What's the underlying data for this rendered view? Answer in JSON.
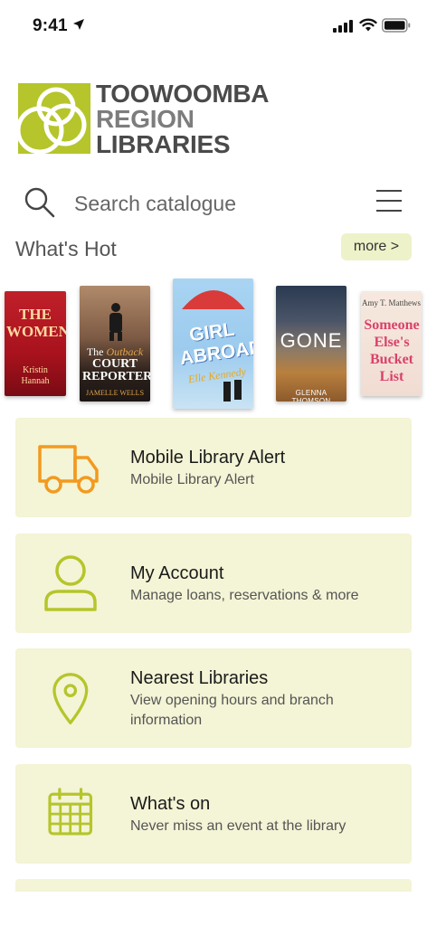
{
  "status_bar": {
    "time": "9:41"
  },
  "logo": {
    "line1": "TOOWOOMBA",
    "line2": "REGION",
    "line3": "LIBRARIES"
  },
  "search": {
    "placeholder": "Search catalogue"
  },
  "whats_hot": {
    "title": "What's Hot",
    "more_label": "more >",
    "books": [
      {
        "title": "THE WOMEN",
        "author": "Kristin Hannah"
      },
      {
        "title_pre": "The",
        "title_script": "Outback",
        "title": "COURT REPORTER",
        "author": "JAMELLE WELLS"
      },
      {
        "title": "GIRL ABROAD",
        "author": "Elle Kennedy"
      },
      {
        "title": "GONE",
        "author": "GLENNA THOMSON"
      },
      {
        "author": "Amy T. Matthews",
        "title": "Someone Else's Bucket List"
      }
    ]
  },
  "cards": [
    {
      "icon": "truck-icon",
      "title": "Mobile Library Alert",
      "subtitle": "Mobile Library Alert"
    },
    {
      "icon": "person-icon",
      "title": "My Account",
      "subtitle": "Manage loans, reservations & more"
    },
    {
      "icon": "map-pin-icon",
      "title": "Nearest Libraries",
      "subtitle": "View opening hours and branch information"
    },
    {
      "icon": "calendar-icon",
      "title": "What's on",
      "subtitle": "Never miss an event at the library"
    }
  ],
  "colors": {
    "accent_green": "#b5c52b",
    "truck_orange": "#f29a1f",
    "card_bg": "#f4f4d6"
  }
}
